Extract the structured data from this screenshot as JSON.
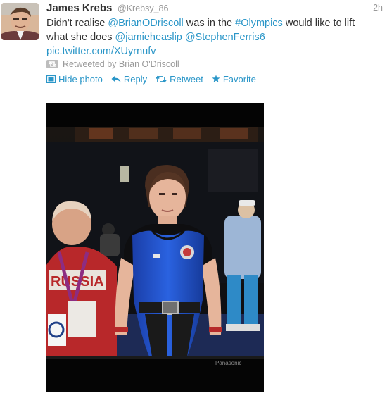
{
  "tweet": {
    "author_name": "James Krebs",
    "author_handle": "@Krebsy_86",
    "timestamp": "2h",
    "text": {
      "t1": "Didn't realise ",
      "m1": "@BrianODriscoll",
      "t2": " was in the ",
      "h1": "#Olympics",
      "t3": " would like to lift what she does ",
      "m2": "@jamieheaslip",
      "t4": " ",
      "m3": "@StephenFerris6",
      "link": "pic.twitter.com/XUyrnufv"
    },
    "retweeted_by": "Retweeted by Brian O'Driscoll"
  },
  "actions": {
    "hide_photo": "Hide photo",
    "reply": "Reply",
    "retweet": "Retweet",
    "favorite": "Favorite"
  },
  "photo": {
    "tv_brand": "Panasonic",
    "shirt_text": "RUSSIA"
  },
  "icons": {
    "retweet_badge": "retweet-icon",
    "hide_photo": "photo-icon",
    "reply": "reply-arrow-icon",
    "retweet": "retweet-icon",
    "favorite": "star-icon"
  },
  "colors": {
    "link": "#2a96c8",
    "name": "#333333",
    "meta": "#999999"
  }
}
